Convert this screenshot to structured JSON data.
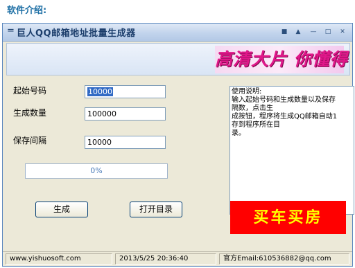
{
  "page_heading": "软件介绍:",
  "window": {
    "title": "巨人QQ邮箱地址批量生成器",
    "sysmenu_symbol": "=",
    "title_buttons": [
      "■",
      "▲",
      "—",
      "□",
      "✕"
    ]
  },
  "banner": {
    "ad_text": "高清大片 你懂得"
  },
  "form": {
    "start_label": "起始号码",
    "start_value": "10000",
    "count_label": "生成数量",
    "count_value": "100000",
    "interval_label": "保存间隔",
    "interval_value": "10000"
  },
  "progress": {
    "text": "0%",
    "value": 0
  },
  "buttons": {
    "generate": "生成",
    "open_dir": "打开目录"
  },
  "notes": {
    "lines": [
      "使用说明:",
      "输入起始号码和生成数量以及保存",
      "隔数，点击生",
      "成按钮，程序将生成QQ邮箱自动1",
      "存到程序所在目",
      "录。"
    ]
  },
  "side_ad": {
    "text": "买车买房"
  },
  "statusbar": {
    "website": "www.yishuosoft.com",
    "datetime": "2013/5/25 20:36:40",
    "email": "官方Email:610536882@qq.com"
  },
  "colors": {
    "heading": "#1d6fa5",
    "ad_pink": "#e0178a",
    "ad_red": "#ff0000",
    "ad_yellow": "#ffff00",
    "selection": "#316ac5"
  }
}
